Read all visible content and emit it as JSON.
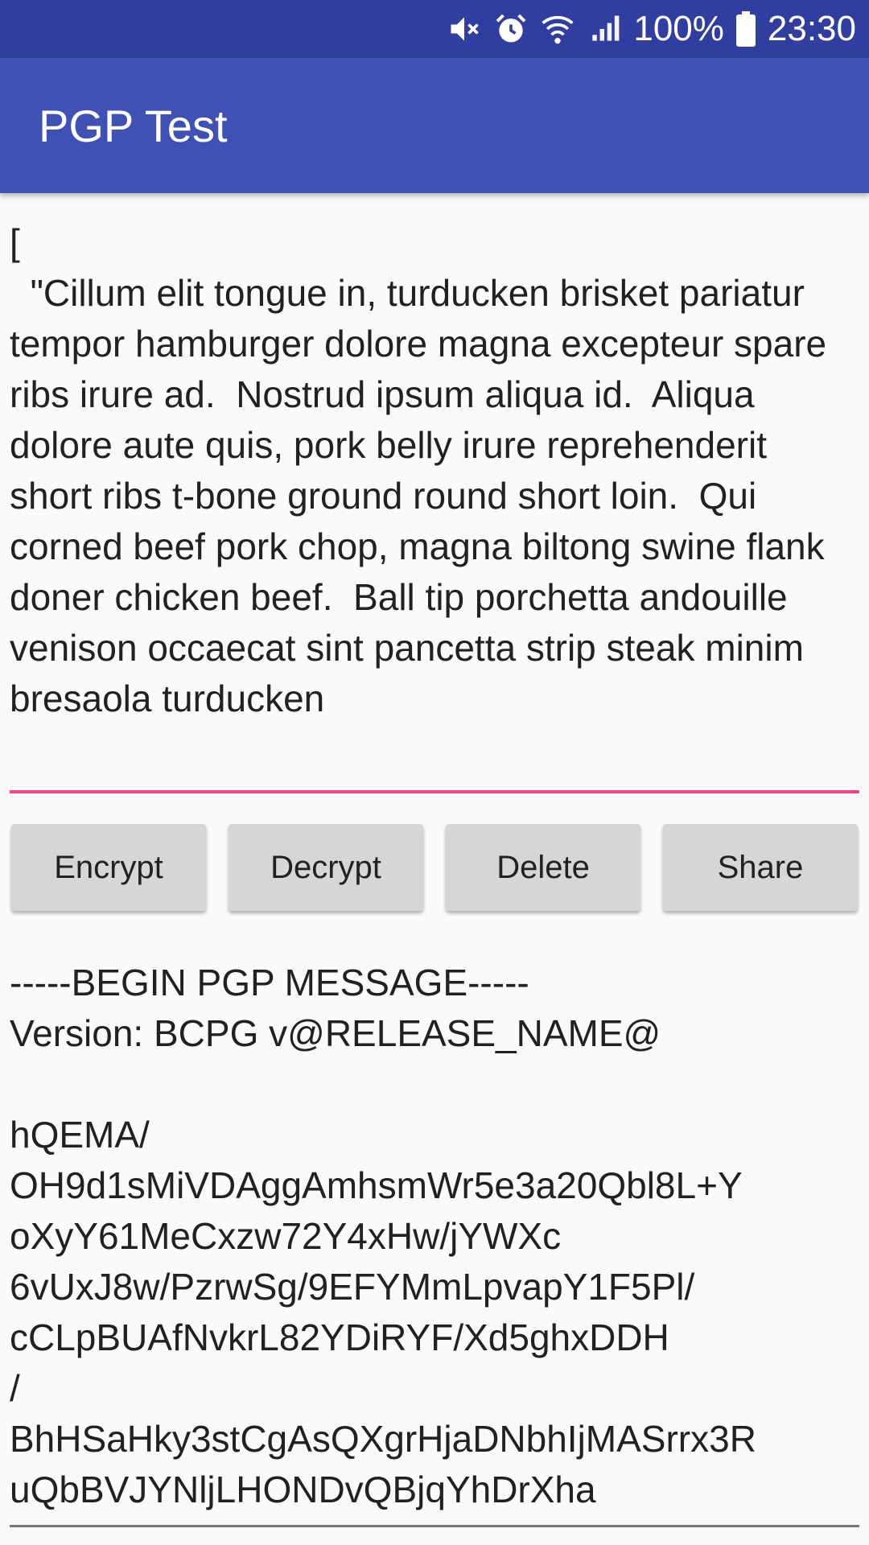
{
  "status_bar": {
    "icons": [
      "mute-vibrate-icon",
      "alarm-icon",
      "wifi-icon",
      "signal-icon",
      "battery-icon"
    ],
    "battery": "100%",
    "time": "23:30"
  },
  "app_bar": {
    "title": "PGP Test"
  },
  "input": {
    "text": "[\n  \"Cillum elit tongue in, turducken brisket pariatur tempor hamburger dolore magna excepteur spare ribs irure ad.  Nostrud ipsum aliqua id.  Aliqua dolore aute quis, pork belly irure reprehenderit short ribs t-bone ground round short loin.  Qui corned beef pork chop, magna biltong swine flank doner chicken beef.  Ball tip porchetta andouille venison occaecat sint pancetta strip steak minim bresaola turducken"
  },
  "buttons": {
    "encrypt": "Encrypt",
    "decrypt": "Decrypt",
    "delete": "Delete",
    "share": "Share"
  },
  "output": {
    "text": "-----BEGIN PGP MESSAGE-----\nVersion: BCPG v@RELEASE_NAME@\n\nhQEMA/\nOH9d1sMiVDAggAmhsmWr5e3a20Qbl8L+Y\noXyY61MeCxzw72Y4xHw/jYWXc\n6vUxJ8w/PzrwSg/9EFYMmLpvapY1F5Pl/\ncCLpBUAfNvkrL82YDiRYF/Xd5ghxDDH\n/\nBhHSaHky3stCgAsQXgrHjaDNbhIjMASrrx3R\nuQbBVJYNljLHONDvQBjqYhDrXha"
  },
  "colors": {
    "status_bar": "#303f9f",
    "app_bar": "#3f51b5",
    "accent": "#ff4081",
    "button": "#d6d6d6"
  }
}
